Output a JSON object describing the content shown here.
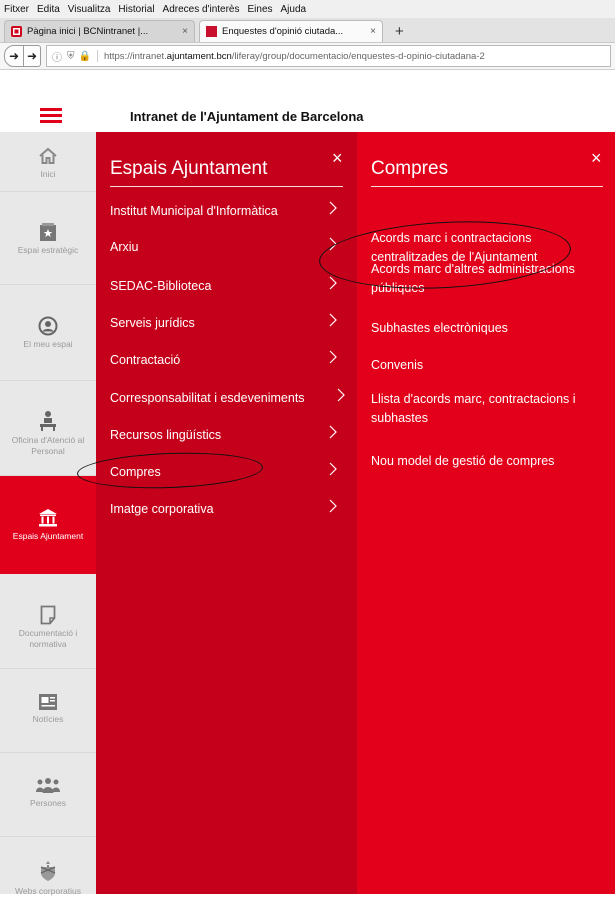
{
  "browser": {
    "menu": [
      "Fitxer",
      "Edita",
      "Visualitza",
      "Historial",
      "Adreces d'interès",
      "Eines",
      "Ajuda"
    ],
    "tabs": [
      {
        "title": "Pàgina inici | BCNintranet |...",
        "close": "×"
      },
      {
        "title": "Enquestes d'opinió ciutada...",
        "close": "×"
      }
    ],
    "new_tab": "+",
    "url_prefix": "https://intranet.",
    "url_domain": "ajuntament.bcn",
    "url_path": "/liferay/group/documentacio/enquestes-d-opinio-ciutadana-2"
  },
  "header": {
    "title": "Intranet de l'Ajuntament de Barcelona"
  },
  "sidebar": {
    "items": [
      {
        "label": "Inici",
        "icon": "home-icon"
      },
      {
        "label": "Espai estratègic",
        "icon": "star-document-icon"
      },
      {
        "label": "El meu espai",
        "icon": "user-circle-icon"
      },
      {
        "label": "Oficina d'Atenció al Personal",
        "icon": "people-desk-icon"
      },
      {
        "label": "Espais Ajuntament",
        "icon": "bank-icon"
      },
      {
        "label": "Documentació i normativa",
        "icon": "document-icon"
      },
      {
        "label": "Notícies",
        "icon": "newspaper-icon"
      },
      {
        "label": "Persones",
        "icon": "group-icon"
      },
      {
        "label": "Webs corporatius",
        "icon": "crest-icon"
      }
    ]
  },
  "panel1": {
    "title": "Espais Ajuntament",
    "close": "×",
    "items": [
      "Institut Municipal d'Informàtica",
      "Arxiu",
      "SEDAC-Biblioteca",
      "Serveis jurídics",
      "Contractació",
      "Corresponsabilitat i esdeveniments",
      "Recursos lingüístics",
      "Compres",
      "Imatge corporativa"
    ]
  },
  "panel2": {
    "title": "Compres",
    "close": "×",
    "items": [
      "Acords marc i contractacions centralitzades de l'Ajuntament",
      "Acords marc d'altres administracions públiques",
      "Subhastes electròniques",
      "Convenis",
      "Llista d'acords marc, contractacions i subhastes",
      "Nou model de gestió de compres"
    ]
  },
  "colors": {
    "brand_red": "#e0001b",
    "panel1_bg": "#c5001b",
    "panel2_bg": "#e2001a",
    "rail_bg": "#e8e8e8"
  }
}
